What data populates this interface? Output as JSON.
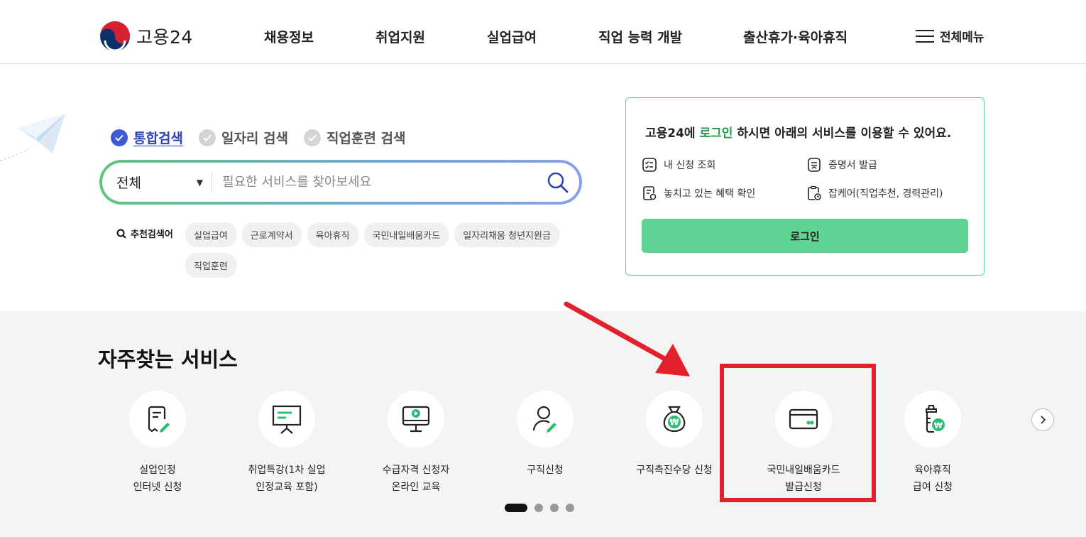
{
  "header": {
    "logo_text": "고용24",
    "nav": [
      "채용정보",
      "취업지원",
      "실업급여",
      "직업 능력 개발",
      "출산휴가·육아휴직"
    ],
    "all_menu_label": "전체메뉴"
  },
  "search": {
    "tabs": [
      "통합검색",
      "일자리 검색",
      "직업훈련 검색"
    ],
    "active_tab": "통합검색",
    "category": "전체",
    "placeholder": "필요한 서비스를 찾아보세요",
    "recommend_label": "추천검색어",
    "chips": [
      "실업급여",
      "근로계약서",
      "육아휴직",
      "국민내일배움카드",
      "일자리채움 청년지원금",
      "직업훈련"
    ]
  },
  "login": {
    "msg_pre": "고용24에 ",
    "msg_link": "로그인",
    "msg_post": " 하시면 아래의 서비스를 이용할 수 있어요.",
    "services": [
      "내 신청 조회",
      "증명서 발급",
      "놓치고 있는 혜택 확인",
      "잡케어(직업추천, 경력관리)"
    ],
    "button_label": "로그인"
  },
  "frequent": {
    "title": "자주찾는 서비스",
    "items": [
      {
        "label": "실업인정\n인터넷 신청",
        "icon": "document-pen-icon"
      },
      {
        "label": "취업특강(1차 실업\n인정교육 포함)",
        "icon": "presentation-board-icon"
      },
      {
        "label": "수급자격 신청자\n온라인 교육",
        "icon": "video-monitor-icon"
      },
      {
        "label": "구직신청",
        "icon": "person-pen-icon"
      },
      {
        "label": "구직촉진수당 신청",
        "icon": "money-bag-icon"
      },
      {
        "label": "국민내일배움카드\n발급신청",
        "icon": "card-icon"
      },
      {
        "label": "육아휴직\n급여 신청",
        "icon": "baby-bottle-icon"
      }
    ],
    "pagination_count": 4,
    "active_page": 1
  },
  "colors": {
    "accent_green": "#5fd391",
    "brand_blue": "#2c44b4",
    "annotation_red": "#e3212d"
  }
}
